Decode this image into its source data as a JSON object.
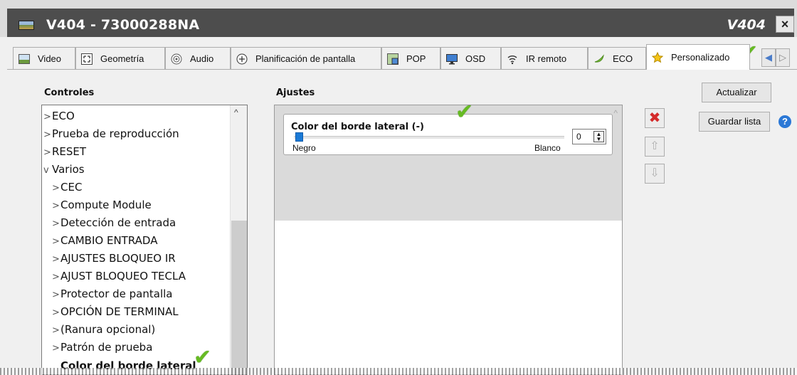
{
  "window": {
    "title": "V404 - 73000288NA",
    "model": "V404",
    "close_label": "×"
  },
  "tabs": [
    {
      "label": "Video",
      "icon": "video-image-icon"
    },
    {
      "label": "Geometría",
      "icon": "geometry-icon"
    },
    {
      "label": "Audio",
      "icon": "speaker-icon"
    },
    {
      "label": "Planificación de pantalla",
      "icon": "clock-plus-icon"
    },
    {
      "label": "POP",
      "icon": "pop-icon"
    },
    {
      "label": "OSD",
      "icon": "monitor-icon"
    },
    {
      "label": "IR remoto",
      "icon": "wireless-icon"
    },
    {
      "label": "ECO",
      "icon": "leaf-icon"
    },
    {
      "label": "Personalizado",
      "icon": "star-icon",
      "active": true
    }
  ],
  "controls": {
    "label": "Controles",
    "items": [
      {
        "label": "ECO",
        "arrow": ">"
      },
      {
        "label": "Prueba de reproducción",
        "arrow": ">"
      },
      {
        "label": "RESET",
        "arrow": ">"
      },
      {
        "label": "Varios",
        "arrow": "v"
      },
      {
        "label": "CEC",
        "arrow": ">"
      },
      {
        "label": "Compute Module",
        "arrow": ">"
      },
      {
        "label": "Detección de entrada",
        "arrow": ">"
      },
      {
        "label": "CAMBIO ENTRADA",
        "arrow": ">"
      },
      {
        "label": "AJUSTES BLOQUEO IR",
        "arrow": ">"
      },
      {
        "label": "AJUST BLOQUEO TECLA",
        "arrow": ">"
      },
      {
        "label": "Protector de pantalla",
        "arrow": ">"
      },
      {
        "label": "OPCIÓN DE TERMINAL",
        "arrow": ">"
      },
      {
        "label": "(Ranura opcional)",
        "arrow": ">"
      },
      {
        "label": "Patrón de prueba",
        "arrow": ">"
      },
      {
        "label": "Color del borde lateral",
        "arrow": ""
      }
    ]
  },
  "settings": {
    "label": "Ajustes",
    "setting_title": "Color del borde lateral (-)",
    "slider_min_label": "Negro",
    "slider_max_label": "Blanco",
    "value": "0",
    "slider_fraction": 0.0
  },
  "actions": {
    "update": "Actualizar",
    "save_list": "Guardar lista",
    "help": "?"
  },
  "colors": {
    "title_bar": "#4d4d4d",
    "accent_blue": "#1b7ad6",
    "check_green": "#66bb22",
    "delete_red": "#d42a2a"
  }
}
